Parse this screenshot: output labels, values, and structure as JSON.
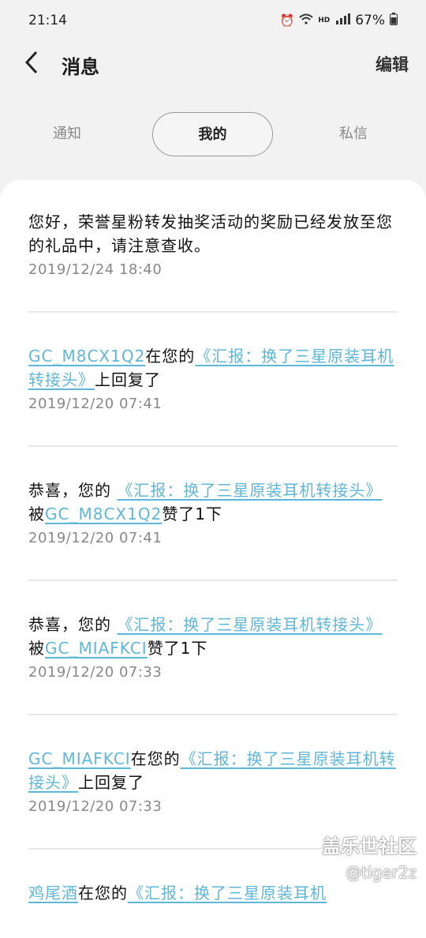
{
  "status": {
    "time": "21:14",
    "battery": "67%",
    "icons": [
      "alarm-icon",
      "wifi-icon",
      "hd-icon",
      "4g-signal-icon",
      "battery-icon"
    ]
  },
  "header": {
    "title": "消息",
    "edit_label": "编辑",
    "back_icon": "chevron-left-icon"
  },
  "tabs": [
    {
      "label": "通知",
      "active": false
    },
    {
      "label": "我的",
      "active": true
    },
    {
      "label": "私信",
      "active": false
    }
  ],
  "messages": [
    {
      "text": "您好，荣誉星粉转发抽奖活动的奖励已经发放至您的礼品中，请注意查收。",
      "time": "2019/12/24  18:40"
    },
    {
      "user": "GC_M8CX1Q2",
      "mid": "在您的",
      "post": "《汇报：换了三星原装耳机转接头》",
      "suffix": "上回复了",
      "time": "2019/12/20  07:41"
    },
    {
      "prefix": "恭喜，您的 ",
      "post": "《汇报：换了三星原装耳机转接头》",
      "mid": "被",
      "user": "GC_M8CX1Q2",
      "suffix": "赞了1下",
      "time": "2019/12/20  07:41"
    },
    {
      "prefix": "恭喜，您的 ",
      "post": "《汇报：换了三星原装耳机转接头》",
      "mid": "被",
      "user": "GC_MIAFKCI",
      "suffix": "赞了1下",
      "time": "2019/12/20  07:33"
    },
    {
      "user": "GC_MIAFKCI",
      "mid": "在您的",
      "post": "《汇报：换了三星原装耳机转接头》",
      "suffix": "上回复了",
      "time": "2019/12/20  07:33"
    },
    {
      "user": "鸡尾酒",
      "mid": "在您的",
      "post": "《汇报：换了三星原装耳机"
    }
  ],
  "watermark": {
    "line1": "盖乐世社区",
    "line2": "@tiger2z"
  },
  "colors": {
    "link": "#5eb7d6",
    "background": "#f2f2f2"
  }
}
